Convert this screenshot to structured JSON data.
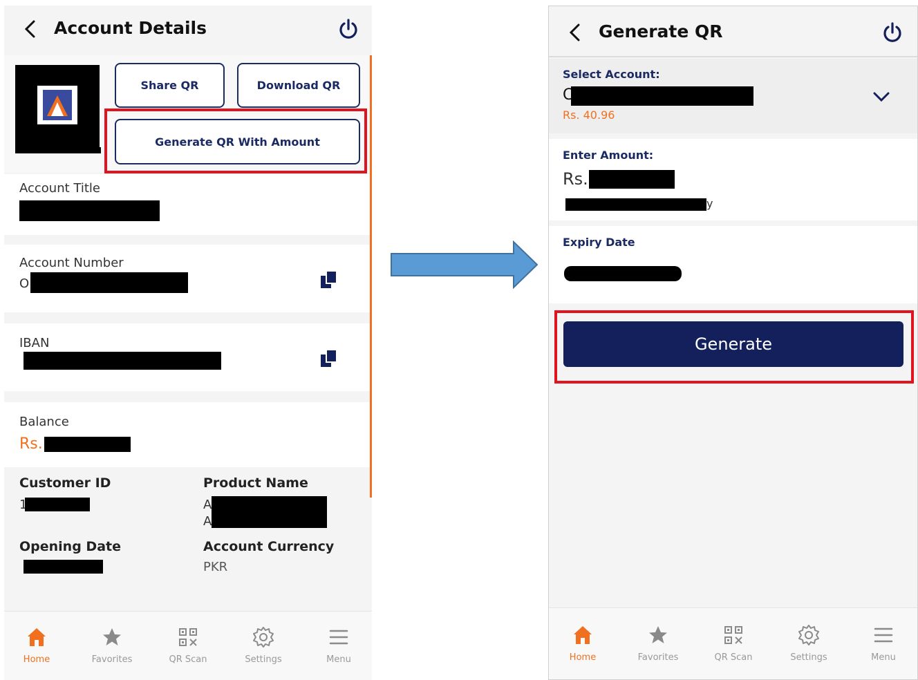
{
  "left": {
    "header": {
      "title": "Account Details"
    },
    "buttons": {
      "share": "Share QR",
      "download": "Download QR",
      "generate_amount": "Generate QR With Amount"
    },
    "account_title": {
      "label": "Account Title"
    },
    "account_number": {
      "label": "Account Number",
      "prefix": "O"
    },
    "iban": {
      "label": "IBAN"
    },
    "balance": {
      "label": "Balance",
      "prefix": "Rs."
    },
    "customer_id": {
      "label": "Customer ID",
      "prefix": "1"
    },
    "product_name": {
      "label": "Product Name",
      "line1": "A",
      "line2": "A"
    },
    "opening_date": {
      "label": "Opening Date"
    },
    "account_currency": {
      "label": "Account Currency",
      "value": "PKR"
    }
  },
  "right": {
    "header": {
      "title": "Generate QR"
    },
    "select_account": {
      "label": "Select Account:",
      "prefix": "C",
      "balance": "Rs. 40.96"
    },
    "enter_amount": {
      "label": "Enter Amount:",
      "prefix": "Rs.",
      "tail": "y"
    },
    "expiry": {
      "label": "Expiry Date"
    },
    "generate_button": "Generate"
  },
  "nav": {
    "items": [
      {
        "label": "Home",
        "icon": "home-icon"
      },
      {
        "label": "Favorites",
        "icon": "star-icon"
      },
      {
        "label": "QR Scan",
        "icon": "qr-icon"
      },
      {
        "label": "Settings",
        "icon": "gear-icon"
      },
      {
        "label": "Menu",
        "icon": "menu-icon"
      }
    ]
  },
  "colors": {
    "brand_navy": "#14205c",
    "accent_orange": "#f07020",
    "highlight_red": "#e0141e",
    "arrow_blue": "#5b9bd5"
  }
}
